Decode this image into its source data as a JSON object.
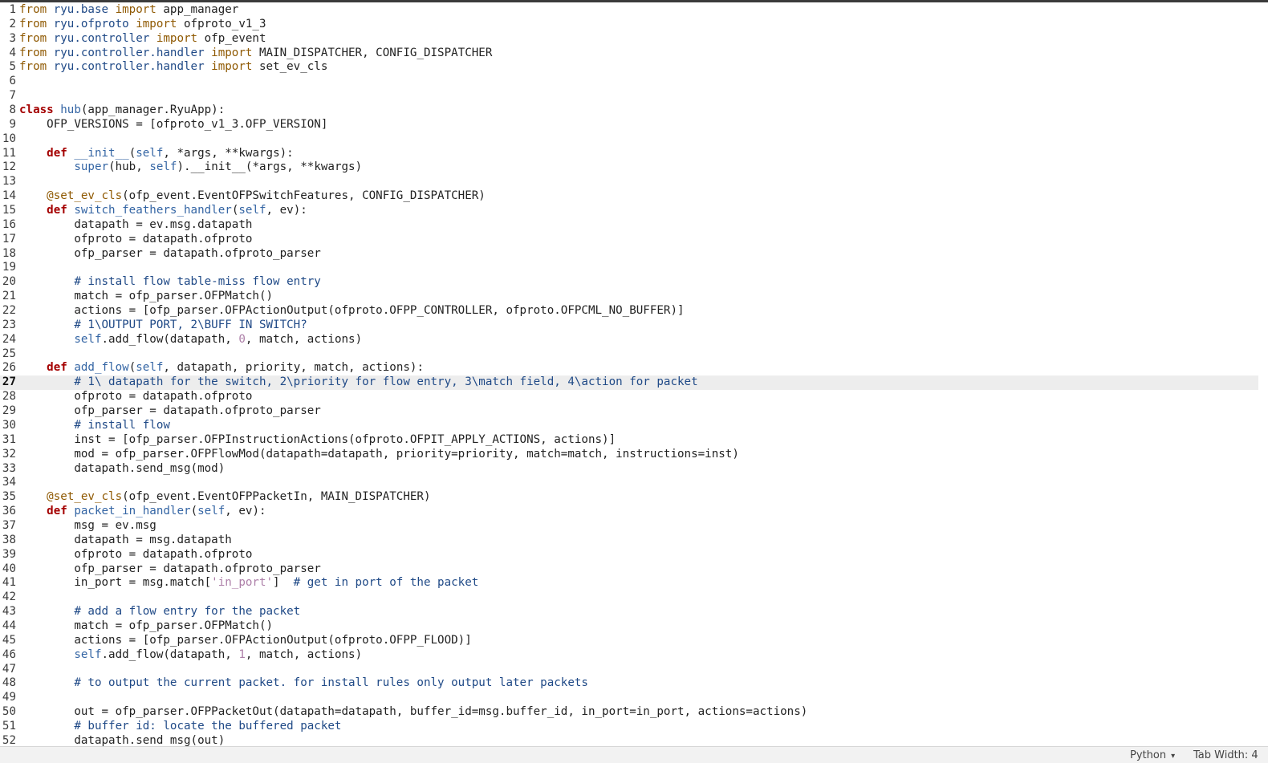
{
  "editor": {
    "current_line": 27,
    "lines": [
      {
        "n": "1",
        "tokens": [
          [
            "kw-from",
            "from"
          ],
          [
            "",
            ""
          ],
          [
            "mod",
            " ryu.base"
          ],
          [
            "kw-import",
            " import"
          ],
          [
            "",
            " app_manager"
          ]
        ]
      },
      {
        "n": "2",
        "tokens": [
          [
            "kw-from",
            "from"
          ],
          [
            "mod",
            " ryu.ofproto"
          ],
          [
            "kw-import",
            " import"
          ],
          [
            "",
            " ofproto_v1_3"
          ]
        ]
      },
      {
        "n": "3",
        "tokens": [
          [
            "kw-from",
            "from"
          ],
          [
            "mod",
            " ryu.controller"
          ],
          [
            "kw-import",
            " import"
          ],
          [
            "",
            " ofp_event"
          ]
        ]
      },
      {
        "n": "4",
        "tokens": [
          [
            "kw-from",
            "from"
          ],
          [
            "mod",
            " ryu.controller.handler"
          ],
          [
            "kw-import",
            " import"
          ],
          [
            "",
            " MAIN_DISPATCHER, CONFIG_DISPATCHER"
          ]
        ]
      },
      {
        "n": "5",
        "tokens": [
          [
            "kw-from",
            "from"
          ],
          [
            "mod",
            " ryu.controller.handler"
          ],
          [
            "kw-import",
            " import"
          ],
          [
            "",
            " set_ev_cls"
          ]
        ]
      },
      {
        "n": "6",
        "tokens": []
      },
      {
        "n": "7",
        "tokens": []
      },
      {
        "n": "8",
        "tokens": [
          [
            "kw-class",
            "class"
          ],
          [
            "",
            " "
          ],
          [
            "fn",
            "hub"
          ],
          [
            "",
            "(app_manager.RyuApp):"
          ]
        ]
      },
      {
        "n": "9",
        "tokens": [
          [
            "",
            "    OFP_VERSIONS = [ofproto_v1_3.OFP_VERSION]"
          ]
        ]
      },
      {
        "n": "10",
        "tokens": []
      },
      {
        "n": "11",
        "tokens": [
          [
            "",
            "    "
          ],
          [
            "kw",
            "def"
          ],
          [
            "",
            " "
          ],
          [
            "fn",
            "__init__"
          ],
          [
            "",
            "("
          ],
          [
            "self",
            "self"
          ],
          [
            "",
            ", *args, **kwargs):"
          ]
        ]
      },
      {
        "n": "12",
        "tokens": [
          [
            "",
            "        "
          ],
          [
            "builtin",
            "super"
          ],
          [
            "",
            "(hub, "
          ],
          [
            "self",
            "self"
          ],
          [
            "",
            ").__init__(*args, **kwargs)"
          ]
        ]
      },
      {
        "n": "13",
        "tokens": []
      },
      {
        "n": "14",
        "tokens": [
          [
            "",
            "    "
          ],
          [
            "deco",
            "@set_ev_cls"
          ],
          [
            "",
            "(ofp_event.EventOFPSwitchFeatures, CONFIG_DISPATCHER)"
          ]
        ]
      },
      {
        "n": "15",
        "tokens": [
          [
            "",
            "    "
          ],
          [
            "kw",
            "def"
          ],
          [
            "",
            " "
          ],
          [
            "fn",
            "switch_feathers_handler"
          ],
          [
            "",
            "("
          ],
          [
            "self",
            "self"
          ],
          [
            "",
            ", ev):"
          ]
        ]
      },
      {
        "n": "16",
        "tokens": [
          [
            "",
            "        datapath = ev.msg.datapath"
          ]
        ]
      },
      {
        "n": "17",
        "tokens": [
          [
            "",
            "        ofproto = datapath.ofproto"
          ]
        ]
      },
      {
        "n": "18",
        "tokens": [
          [
            "",
            "        ofp_parser = datapath.ofproto_parser"
          ]
        ]
      },
      {
        "n": "19",
        "tokens": []
      },
      {
        "n": "20",
        "tokens": [
          [
            "",
            "        "
          ],
          [
            "comment",
            "# install flow table-miss flow entry"
          ]
        ]
      },
      {
        "n": "21",
        "tokens": [
          [
            "",
            "        match = ofp_parser.OFPMatch()"
          ]
        ]
      },
      {
        "n": "22",
        "tokens": [
          [
            "",
            "        actions = [ofp_parser.OFPActionOutput(ofproto.OFPP_CONTROLLER, ofproto.OFPCML_NO_BUFFER)]"
          ]
        ]
      },
      {
        "n": "23",
        "tokens": [
          [
            "",
            "        "
          ],
          [
            "comment",
            "# 1\\OUTPUT PORT, 2\\BUFF IN SWITCH?"
          ]
        ]
      },
      {
        "n": "24",
        "tokens": [
          [
            "",
            "        "
          ],
          [
            "self",
            "self"
          ],
          [
            "",
            ".add_flow(datapath, "
          ],
          [
            "num",
            "0"
          ],
          [
            "",
            ", match, actions)"
          ]
        ]
      },
      {
        "n": "25",
        "tokens": []
      },
      {
        "n": "26",
        "tokens": [
          [
            "",
            "    "
          ],
          [
            "kw",
            "def"
          ],
          [
            "",
            " "
          ],
          [
            "fn",
            "add_flow"
          ],
          [
            "",
            "("
          ],
          [
            "self",
            "self"
          ],
          [
            "",
            ", datapath, priority, match, actions):"
          ]
        ]
      },
      {
        "n": "27",
        "tokens": [
          [
            "",
            "        "
          ],
          [
            "comment",
            "# 1\\ datapath for the switch, 2\\priority for flow entry, 3\\match field, 4\\action for packet"
          ]
        ]
      },
      {
        "n": "28",
        "tokens": [
          [
            "",
            "        ofproto = datapath.ofproto"
          ]
        ]
      },
      {
        "n": "29",
        "tokens": [
          [
            "",
            "        ofp_parser = datapath.ofproto_parser"
          ]
        ]
      },
      {
        "n": "30",
        "tokens": [
          [
            "",
            "        "
          ],
          [
            "comment",
            "# install flow"
          ]
        ]
      },
      {
        "n": "31",
        "tokens": [
          [
            "",
            "        inst = [ofp_parser.OFPInstructionActions(ofproto.OFPIT_APPLY_ACTIONS, actions)]"
          ]
        ]
      },
      {
        "n": "32",
        "tokens": [
          [
            "",
            "        mod = ofp_parser.OFPFlowMod(datapath=datapath, priority=priority, match=match, instructions=inst)"
          ]
        ]
      },
      {
        "n": "33",
        "tokens": [
          [
            "",
            "        datapath.send_msg(mod)"
          ]
        ]
      },
      {
        "n": "34",
        "tokens": []
      },
      {
        "n": "35",
        "tokens": [
          [
            "",
            "    "
          ],
          [
            "deco",
            "@set_ev_cls"
          ],
          [
            "",
            "(ofp_event.EventOFPPacketIn, MAIN_DISPATCHER)"
          ]
        ]
      },
      {
        "n": "36",
        "tokens": [
          [
            "",
            "    "
          ],
          [
            "kw",
            "def"
          ],
          [
            "",
            " "
          ],
          [
            "fn",
            "packet_in_handler"
          ],
          [
            "",
            "("
          ],
          [
            "self",
            "self"
          ],
          [
            "",
            ", ev):"
          ]
        ]
      },
      {
        "n": "37",
        "tokens": [
          [
            "",
            "        msg = ev.msg"
          ]
        ]
      },
      {
        "n": "38",
        "tokens": [
          [
            "",
            "        datapath = msg.datapath"
          ]
        ]
      },
      {
        "n": "39",
        "tokens": [
          [
            "",
            "        ofproto = datapath.ofproto"
          ]
        ]
      },
      {
        "n": "40",
        "tokens": [
          [
            "",
            "        ofp_parser = datapath.ofproto_parser"
          ]
        ]
      },
      {
        "n": "41",
        "tokens": [
          [
            "",
            "        in_port = msg.match["
          ],
          [
            "str",
            "'in_port'"
          ],
          [
            "",
            "]  "
          ],
          [
            "comment",
            "# get in port of the packet"
          ]
        ]
      },
      {
        "n": "42",
        "tokens": []
      },
      {
        "n": "43",
        "tokens": [
          [
            "",
            "        "
          ],
          [
            "comment",
            "# add a flow entry for the packet"
          ]
        ]
      },
      {
        "n": "44",
        "tokens": [
          [
            "",
            "        match = ofp_parser.OFPMatch()"
          ]
        ]
      },
      {
        "n": "45",
        "tokens": [
          [
            "",
            "        actions = [ofp_parser.OFPActionOutput(ofproto.OFPP_FLOOD)]"
          ]
        ]
      },
      {
        "n": "46",
        "tokens": [
          [
            "",
            "        "
          ],
          [
            "self",
            "self"
          ],
          [
            "",
            ".add_flow(datapath, "
          ],
          [
            "num",
            "1"
          ],
          [
            "",
            ", match, actions)"
          ]
        ]
      },
      {
        "n": "47",
        "tokens": []
      },
      {
        "n": "48",
        "tokens": [
          [
            "",
            "        "
          ],
          [
            "comment",
            "# to output the current packet. for install rules only output later packets"
          ]
        ]
      },
      {
        "n": "49",
        "tokens": []
      },
      {
        "n": "50",
        "tokens": [
          [
            "",
            "        out = ofp_parser.OFPPacketOut(datapath=datapath, buffer_id=msg.buffer_id, in_port=in_port, actions=actions)"
          ]
        ]
      },
      {
        "n": "51",
        "tokens": [
          [
            "",
            "        "
          ],
          [
            "comment",
            "# buffer id: locate the buffered packet"
          ]
        ]
      },
      {
        "n": "52",
        "tokens": [
          [
            "",
            "        datapath.send_msg(out)"
          ]
        ]
      }
    ]
  },
  "statusbar": {
    "language": "Python",
    "tab_width": "Tab Width: 4"
  }
}
